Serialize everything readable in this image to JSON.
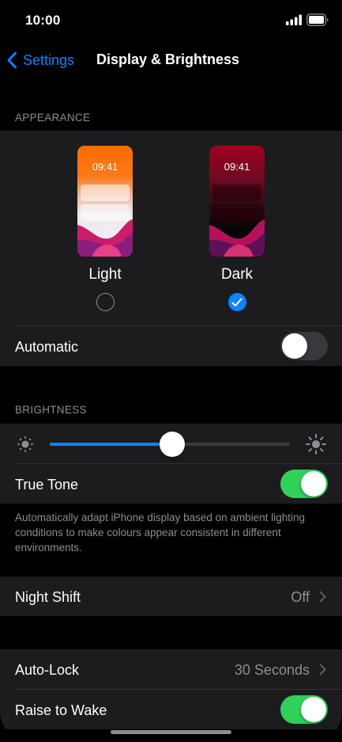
{
  "status_bar": {
    "time": "10:00",
    "icons": [
      "signal-icon",
      "battery-icon"
    ]
  },
  "nav": {
    "back_label": "Settings",
    "title": "Display & Brightness"
  },
  "appearance": {
    "header": "APPEARANCE",
    "options": [
      {
        "label": "Light",
        "preview_time": "09:41",
        "selected": false
      },
      {
        "label": "Dark",
        "preview_time": "09:41",
        "selected": true
      }
    ],
    "automatic": {
      "label": "Automatic",
      "on": false
    }
  },
  "brightness": {
    "header": "BRIGHTNESS",
    "level": 0.51,
    "true_tone": {
      "label": "True Tone",
      "on": true
    },
    "footnote": "Automatically adapt iPhone display based on ambient lighting conditions to make colours appear consistent in different environments."
  },
  "night_shift": {
    "label": "Night Shift",
    "value": "Off"
  },
  "auto_lock": {
    "label": "Auto-Lock",
    "value": "30 Seconds"
  },
  "raise_to_wake": {
    "label": "Raise to Wake",
    "on": true
  },
  "colors": {
    "accent": "#0a84ff",
    "toggle_on": "#30d158",
    "group_bg": "#1c1c1e",
    "page_bg": "#000000",
    "secondary_text": "#8d8d93"
  }
}
